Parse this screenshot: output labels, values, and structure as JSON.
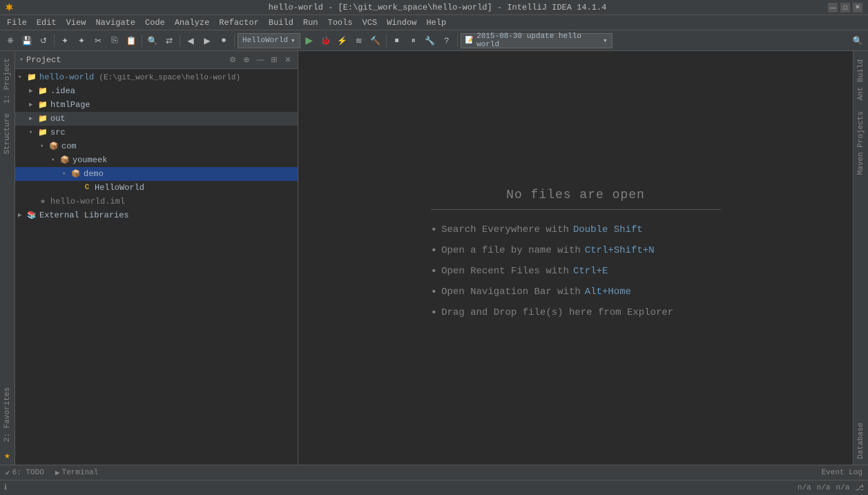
{
  "titleBar": {
    "title": "hello-world - [E:\\git_work_space\\hello-world] - IntelliJ IDEA 14.1.4",
    "minimize": "—",
    "maximize": "□",
    "close": "✕"
  },
  "menuBar": {
    "items": [
      "File",
      "Edit",
      "View",
      "Navigate",
      "Code",
      "Analyze",
      "Refactor",
      "Build",
      "Run",
      "Tools",
      "VCS",
      "Window",
      "Help"
    ]
  },
  "toolbar": {
    "runConfig": "HelloWorld",
    "commitMsg": "2015-08-30 update hello world"
  },
  "projectPanel": {
    "title": "Project",
    "root": "hello-world (E:\\git_work_space\\hello-world)",
    "items": [
      {
        "id": "idea",
        "label": ".idea",
        "indent": 1,
        "type": "folder",
        "expanded": false
      },
      {
        "id": "htmlPage",
        "label": "htmlPage",
        "indent": 1,
        "type": "folder",
        "expanded": false
      },
      {
        "id": "out",
        "label": "out",
        "indent": 1,
        "type": "folder",
        "expanded": false
      },
      {
        "id": "src",
        "label": "src",
        "indent": 1,
        "type": "src-folder",
        "expanded": true
      },
      {
        "id": "com",
        "label": "com",
        "indent": 2,
        "type": "package",
        "expanded": true
      },
      {
        "id": "youmeek",
        "label": "youmeek",
        "indent": 3,
        "type": "package",
        "expanded": true
      },
      {
        "id": "demo",
        "label": "demo",
        "indent": 4,
        "type": "package",
        "expanded": true,
        "selected": true
      },
      {
        "id": "HelloWorld",
        "label": "HelloWorld",
        "indent": 5,
        "type": "java",
        "expanded": false
      },
      {
        "id": "hello-world-iml",
        "label": "hello-world.iml",
        "indent": 1,
        "type": "iml",
        "expanded": false
      },
      {
        "id": "external-libraries",
        "label": "External Libraries",
        "indent": 0,
        "type": "ext-lib",
        "expanded": false
      }
    ]
  },
  "editor": {
    "noFilesTitle": "No files are open",
    "hints": [
      {
        "text": "Search Everywhere with ",
        "key": "Double Shift"
      },
      {
        "text": "Open a file by name with ",
        "key": "Ctrl+Shift+N"
      },
      {
        "text": "Open Recent Files with ",
        "key": "Ctrl+E"
      },
      {
        "text": "Open Navigation Bar with ",
        "key": "Alt+Home"
      },
      {
        "text": "Drag and Drop file(s) here from Explorer",
        "key": ""
      }
    ]
  },
  "rightSidebar": {
    "labels": [
      "Ant Build",
      "Maven Projects",
      "Database"
    ]
  },
  "leftSidebar": {
    "labels": [
      "1: Project",
      "2: Favorites",
      "Structure"
    ]
  },
  "statusBar": {
    "todo": "6: TODO",
    "terminal": "Terminal",
    "eventLog": "Event Log",
    "positions": [
      "n/a",
      "n/a",
      "n/a"
    ]
  }
}
